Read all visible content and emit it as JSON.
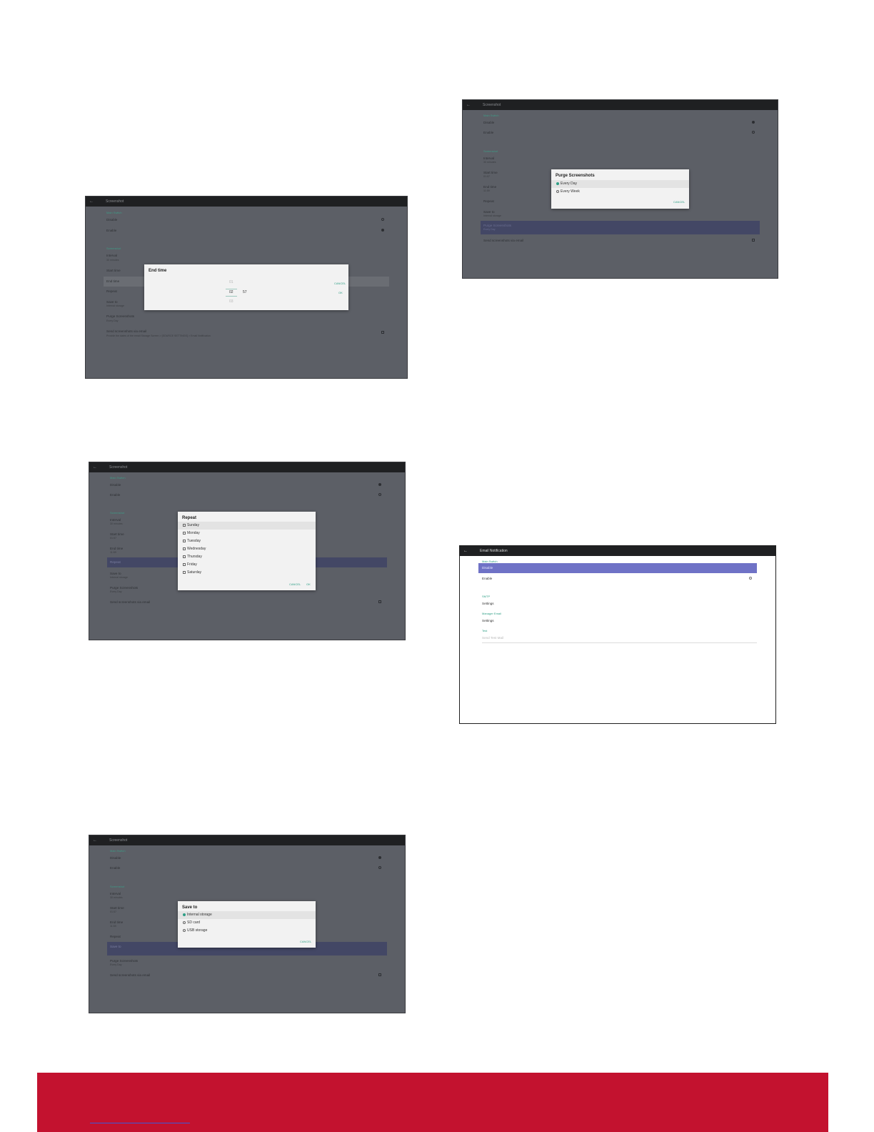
{
  "common": {
    "back_icon": "back-arrow-icon",
    "title": "Screenshot",
    "sec_screenshot": "Main Switch",
    "disable": "Disable",
    "enable": "Enable",
    "sec_schedule": "Screenshot",
    "interval": "Interval",
    "interval_value": "30 minutes",
    "start_time": "Start time",
    "start_time_value": "01:57",
    "end_time": "End time",
    "end_time_value": "11:59",
    "repeat": "Repeat",
    "save_to": "Save to",
    "save_to_value": "Internal storage",
    "purge": "Purge Screenshots",
    "purge_value": "Every Day",
    "send_email": "Send screenshots via email",
    "send_email_desc": "Provide the dates of the email Storage Screen > [SOURCE SETTINGS] > Email Notification"
  },
  "end_time_dialog": {
    "title": "End time",
    "hour_prev": "01",
    "hour": "02",
    "hour_next": "03",
    "minute": "57",
    "cancel": "CANCEL",
    "ok": "OK"
  },
  "repeat_dialog": {
    "title": "Repeat",
    "days": [
      "Sunday",
      "Monday",
      "Tuesday",
      "Wednesday",
      "Thursday",
      "Friday",
      "Saturday"
    ],
    "cancel": "CANCEL",
    "ok": "OK"
  },
  "save_dialog": {
    "title": "Save to",
    "options": [
      "Internal storage",
      "SD card",
      "USB storage"
    ],
    "cancel": "CANCEL"
  },
  "purge_dialog": {
    "title": "Purge Screenshots",
    "options": [
      "Every Day",
      "Every Week"
    ],
    "cancel": "CANCEL"
  },
  "email": {
    "title": "Email Notification",
    "sec_main": "Main Switch",
    "disable": "Disable",
    "enable": "Enable",
    "sec_smtp": "SMTP",
    "smtp_settings": "Settings",
    "sec_manager": "Manager Email",
    "manager_settings": "Settings",
    "sec_test": "Test",
    "send_test": "Send Test Mail"
  },
  "colors": {
    "footer": "#c3122f",
    "highlight": "#434765",
    "email_highlight": "#6f72c6",
    "accent": "#2f9f86"
  }
}
